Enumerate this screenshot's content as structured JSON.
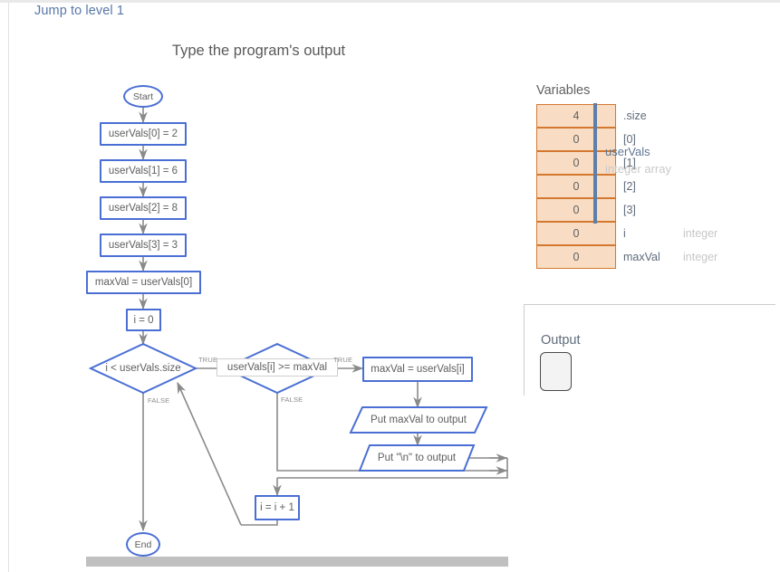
{
  "header": {
    "jump_link": "Jump to level 1",
    "activity_title": "Type the program's output"
  },
  "flowchart": {
    "start_label": "Start",
    "end_label": "End",
    "nodes": [
      {
        "id": "assign0",
        "text": "userVals[0] = 2"
      },
      {
        "id": "assign1",
        "text": "userVals[1] = 6"
      },
      {
        "id": "assign2",
        "text": "userVals[2] = 8"
      },
      {
        "id": "assign3",
        "text": "userVals[3] = 3"
      },
      {
        "id": "maxinit",
        "text": "maxVal = userVals[0]"
      },
      {
        "id": "iinit",
        "text": "i = 0"
      },
      {
        "id": "cond1",
        "text": "i < userVals.size"
      },
      {
        "id": "cond2",
        "text": "userVals[i] >= maxVal"
      },
      {
        "id": "maxassign",
        "text": "maxVal = userVals[i]"
      },
      {
        "id": "put1",
        "text": "Put maxVal to output"
      },
      {
        "id": "put2",
        "text": "Put \"\\n\" to output"
      },
      {
        "id": "incr",
        "text": "i = i + 1"
      }
    ],
    "edge_labels": {
      "true1": "TRUE",
      "false1": "FALSE",
      "true2": "TRUE",
      "false2": "FALSE"
    }
  },
  "variables": {
    "title": "Variables",
    "rows": [
      {
        "value": "4",
        "name": ".size",
        "type": ""
      },
      {
        "value": "0",
        "name": "[0]",
        "type": ""
      },
      {
        "value": "0",
        "name": "[1]",
        "type": ""
      },
      {
        "value": "0",
        "name": "[2]",
        "type": ""
      },
      {
        "value": "0",
        "name": "[3]",
        "type": ""
      },
      {
        "value": "0",
        "name": "i",
        "type": "integer"
      },
      {
        "value": "0",
        "name": "maxVal",
        "type": "integer"
      }
    ],
    "array_group": {
      "name": "userVals",
      "type": "integer array"
    }
  },
  "output": {
    "label": "Output",
    "value": "",
    "placeholder": ""
  },
  "colors": {
    "link": "#5877a8",
    "node_border": "#4a6fd4",
    "edge": "#8a8a8a",
    "var_fill": "#f8ddc4",
    "var_border": "#d4782f",
    "bracket": "#5d7fa8",
    "scrollbar": "#c0c0c0"
  }
}
